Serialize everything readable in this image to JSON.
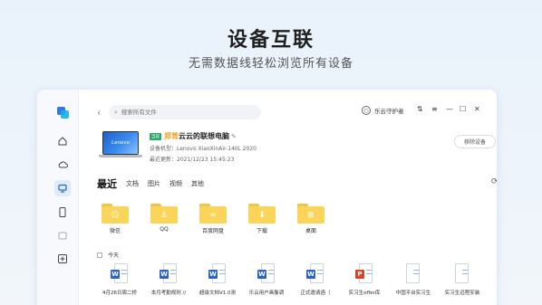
{
  "hero": {
    "title": "设备互联",
    "subtitle": "无需数据线轻松浏览所有设备"
  },
  "toolbar": {
    "search_placeholder": "搜索所有文件",
    "user_name": "乐云守护者"
  },
  "device": {
    "tag": "当前",
    "name_highlight": "郑茸",
    "name_rest": "云云的联想电脑",
    "model": "设备机型：Lenovo XiaoXinAir-14IIL 2020",
    "updated": "最近更新：2021/12/23 15:45:23",
    "screen_brand": "Lenovo",
    "remove_label": "移除设备"
  },
  "recent": {
    "title": "最近",
    "tabs": [
      "文档",
      "图片",
      "视频",
      "其他"
    ]
  },
  "folders": [
    {
      "label": "微信",
      "icon": "wechat-icon"
    },
    {
      "label": "QQ",
      "icon": "qq-icon"
    },
    {
      "label": "百度网盘",
      "icon": "cloud-icon"
    },
    {
      "label": "下载",
      "icon": "download-icon"
    },
    {
      "label": "桌面",
      "icon": "windows-icon"
    }
  ],
  "today_label": "今天",
  "files": [
    {
      "name": "4月26日周二桥",
      "type": "word"
    },
    {
      "name": "本月考勤规则 //",
      "type": "word"
    },
    {
      "name": "超级文档V1.0测",
      "type": "word"
    },
    {
      "name": "乐云用户画像调",
      "type": "word"
    },
    {
      "name": "正式邀请函（",
      "type": "word"
    },
    {
      "name": "实习生offer库",
      "type": "ppt"
    },
    {
      "name": "中国平台实习生",
      "type": "plain"
    },
    {
      "name": "实习生远程安装",
      "type": "plain"
    }
  ],
  "colors": {
    "accent": "#2b63c4",
    "folder": "#fbd45a",
    "tag": "#2aa96b"
  }
}
